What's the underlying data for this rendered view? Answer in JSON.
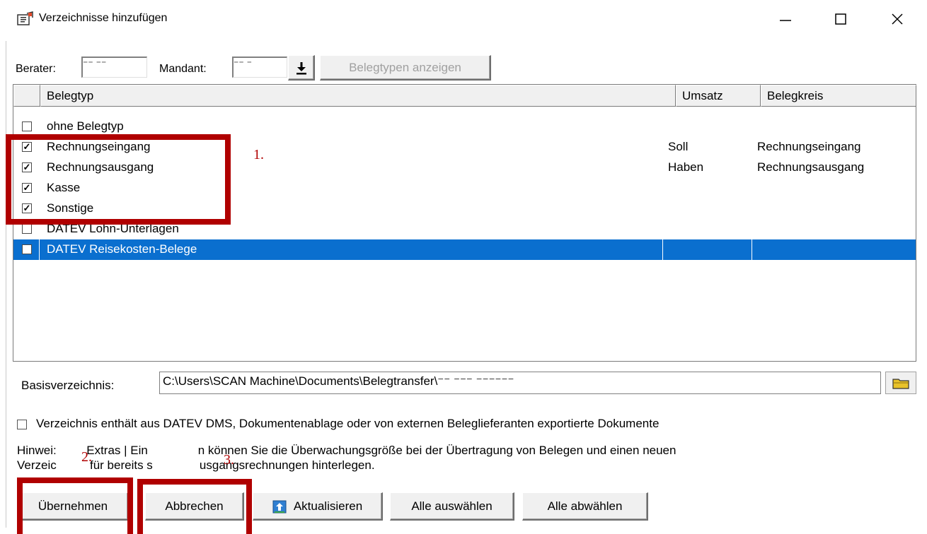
{
  "window": {
    "title": "Verzeichnisse hinzufügen",
    "minimize_glyph": "—",
    "maximize_glyph": "☐",
    "close_glyph": "✕"
  },
  "toolbar": {
    "berater_label": "Berater:",
    "berater_value": "   ⁻⁻ ⁻⁻",
    "mandant_label": "Mandant:",
    "mandant_value": "⁻⁻ ⁻",
    "belegtypen_button": "Belegtypen anzeigen",
    "download_icon": "download-arrow-icon"
  },
  "list": {
    "headers": {
      "belegtyp": "Belegtyp",
      "umsatz": "Umsatz",
      "belegkreis": "Belegkreis"
    },
    "rows": [
      {
        "checked": "",
        "belegtyp": "ohne Belegtyp",
        "umsatz": "",
        "belegkreis": ""
      },
      {
        "checked": "✓",
        "belegtyp": "Rechnungseingang",
        "umsatz": "Soll",
        "belegkreis": "Rechnungseingang"
      },
      {
        "checked": "✓",
        "belegtyp": "Rechnungsausgang",
        "umsatz": "Haben",
        "belegkreis": "Rechnungsausgang"
      },
      {
        "checked": "✓",
        "belegtyp": "Kasse",
        "umsatz": "",
        "belegkreis": ""
      },
      {
        "checked": "✓",
        "belegtyp": "Sonstige",
        "umsatz": "",
        "belegkreis": ""
      },
      {
        "checked": "",
        "belegtyp": "DATEV Lohn-Unterlagen",
        "umsatz": "",
        "belegkreis": ""
      },
      {
        "checked": "",
        "belegtyp": "DATEV Reisekosten-Belege",
        "umsatz": "",
        "belegkreis": "",
        "selected": true
      }
    ],
    "selection_color": "#0a6fcf"
  },
  "basis": {
    "label": "Basisverzeichnis:",
    "path": "C:\\Users\\SCAN Machine\\Documents\\Belegtransfer\\⁻⁻ ⁻⁻⁻ ⁻⁻⁻⁻⁻⁻"
  },
  "export_checkbox": {
    "checked": false,
    "label": "Verzeichnis enthält aus DATEV DMS, Dokumentenablage oder von externen Beleglieferanten exportierte Dokumente"
  },
  "hint": {
    "line1": "Hinwei:         Extras | Ein               n können Sie die Überwachungsgröße bei der Übertragung von Belegen und einen neuen",
    "line2": "Verzeic          für bereits s              usgangsrechnungen hinterlegen."
  },
  "buttons": {
    "uebernehmen": "Übernehmen",
    "abbrechen": "Abbrechen",
    "aktualisieren": "Aktualisieren",
    "alle_auswaehlen": "Alle auswählen",
    "alle_abwaehlen": "Alle abwählen"
  },
  "annotations": {
    "a1": "1.",
    "a2": "2.",
    "a3": "3.",
    "color": "#b00000"
  }
}
